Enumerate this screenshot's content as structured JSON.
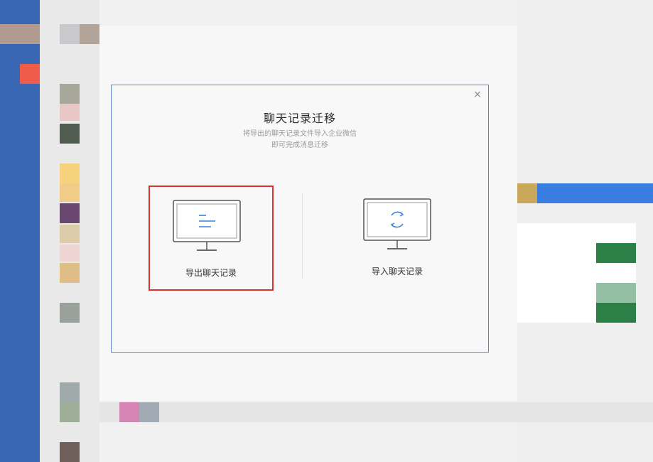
{
  "dialog": {
    "title": "聊天记录迁移",
    "subtitle_line1": "将导出的聊天记录文件导入企业微信",
    "subtitle_line2": "即可完成消息迁移",
    "close_label": "×"
  },
  "options": {
    "export": {
      "label": "导出聊天记录",
      "icon": "monitor-lines-icon",
      "selected": true
    },
    "import": {
      "label": "导入聊天记录",
      "icon": "monitor-sync-icon",
      "selected": false
    }
  },
  "colors": {
    "sidebar": "#3a67b3",
    "dialog_border": "#5a86c8",
    "highlight_border": "#d6342d",
    "icon_accent": "#3b7fd6",
    "monitor_stroke": "#555555"
  }
}
